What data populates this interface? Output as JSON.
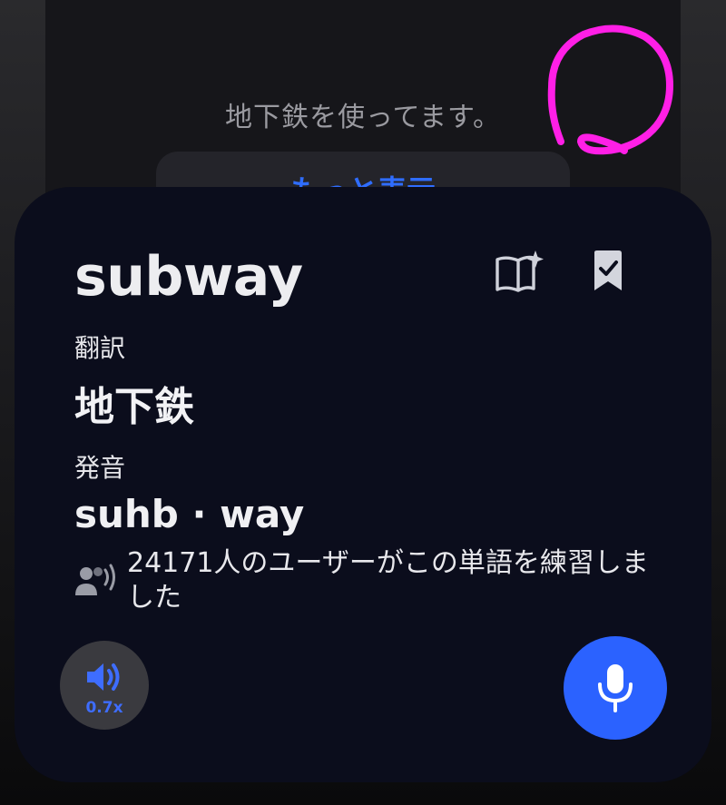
{
  "background": {
    "sentence": "地下鉄を使ってます。",
    "button_label": "もっと表示"
  },
  "card": {
    "word": "subway",
    "translation_label": "翻訳",
    "translation": "地下鉄",
    "pronunciation_label": "発音",
    "pronunciation": "suhb · way",
    "users_text": "24171人のユーザーがこの単語を練習しました",
    "speed": "0.7x"
  },
  "icons": {
    "dictionary": "book-sparkle-icon",
    "bookmark": "bookmark-check-icon",
    "users": "users-audio-icon",
    "speaker": "speaker-icon",
    "mic": "microphone-icon"
  },
  "colors": {
    "sheet_bg": "#0b0d1c",
    "accent": "#2b62ff",
    "annotation": "#ff1fe6"
  }
}
